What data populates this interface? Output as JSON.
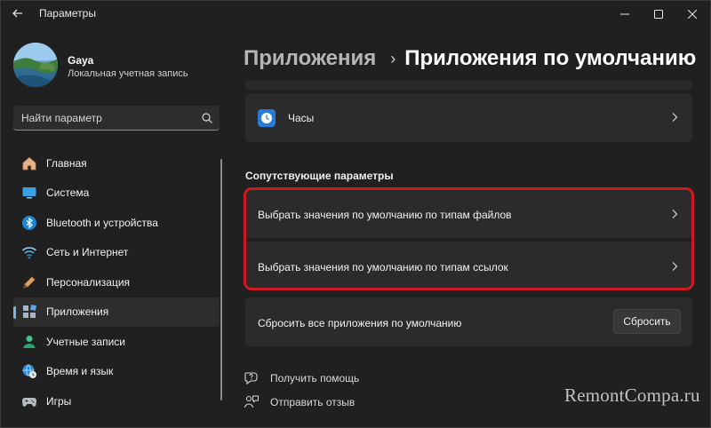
{
  "window": {
    "title": "Параметры",
    "controls": {
      "minimize": "minimize-icon",
      "maximize": "maximize-icon",
      "close": "close-icon"
    }
  },
  "profile": {
    "name": "Gaya",
    "account_type": "Локальная учетная запись"
  },
  "search": {
    "placeholder": "Найти параметр"
  },
  "sidebar": {
    "items": [
      {
        "label": "Главная",
        "icon": "home-icon",
        "active": false
      },
      {
        "label": "Система",
        "icon": "system-icon",
        "active": false
      },
      {
        "label": "Bluetooth и устройства",
        "icon": "bluetooth-icon",
        "active": false
      },
      {
        "label": "Сеть и Интернет",
        "icon": "wifi-icon",
        "active": false
      },
      {
        "label": "Персонализация",
        "icon": "pen-icon",
        "active": false
      },
      {
        "label": "Приложения",
        "icon": "apps-icon",
        "active": true
      },
      {
        "label": "Учетные записи",
        "icon": "account-icon",
        "active": false
      },
      {
        "label": "Время и язык",
        "icon": "globe-clock-icon",
        "active": false
      },
      {
        "label": "Игры",
        "icon": "gamepad-icon",
        "active": false
      }
    ]
  },
  "breadcrumb": {
    "parent": "Приложения",
    "separator": "›",
    "current": "Приложения по умолчанию"
  },
  "main": {
    "clock_item": {
      "label": "Часы",
      "icon": "clock-icon"
    },
    "related_title": "Сопутствующие параметры",
    "file_types": "Выбрать значения по умолчанию по типам файлов",
    "link_types": "Выбрать значения по умолчанию по типам ссылок",
    "reset": {
      "label": "Сбросить все приложения по умолчанию",
      "button": "Сбросить"
    },
    "help": "Получить помощь",
    "feedback": "Отправить отзыв"
  },
  "watermark": "RemontCompa.ru",
  "colors": {
    "background": "#202020",
    "card": "#2b2b2b",
    "accent": "#7bb6ea",
    "highlight": "#d01822"
  }
}
